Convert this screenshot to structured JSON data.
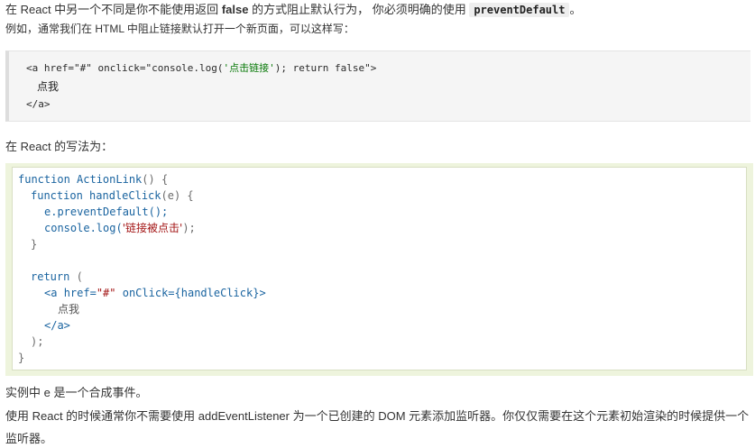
{
  "intro": {
    "line1_prefix": "在 React 中另一个不同是你不能使用返回",
    "line1_bold": "false",
    "line1_mid": "的方式阻止默认行为， 你必须明确的使用",
    "line1_code": "preventDefault",
    "line1_end": "。",
    "line2": "例如，通常我们在 HTML 中阻止链接默认打开一个新页面，可以这样写："
  },
  "code_html": {
    "line1_a": "<a href=\"#\" onclick=\"console.log(",
    "line1_str": "'点击链接'",
    "line1_b": "); return false\">",
    "line2": "点我",
    "line3": "</a>"
  },
  "react_heading": "在 React 的写法为：",
  "code_react": {
    "l1_kw": "function",
    "l1_fn": "ActionLink",
    "l1_rest": "() {",
    "l2_kw": "function",
    "l2_fn": "handleClick",
    "l2_rest": "(e) {",
    "l3": "e.preventDefault();",
    "l4_a": "console.log(",
    "l4_str": "'链接被点击'",
    "l4_b": ");",
    "l5": "}",
    "l7_kw": "return",
    "l7_rest": "(",
    "l8_tag": "<a",
    "l8_attr": "href=",
    "l8_val": "\"#\"",
    "l8_on": "onClick=",
    "l8_expr": "{handleClick}",
    "l8_close": ">",
    "l9": "点我",
    "l10": "</a>",
    "l11": ");",
    "l12": "}"
  },
  "outro": {
    "line1": "实例中 e 是一个合成事件。",
    "line2": "使用 React 的时候通常你不需要使用 addEventListener 为一个已创建的 DOM 元素添加监听器。你仅仅需要在这个元素初始渲染的时候提供一个",
    "line3": "监听器。"
  }
}
